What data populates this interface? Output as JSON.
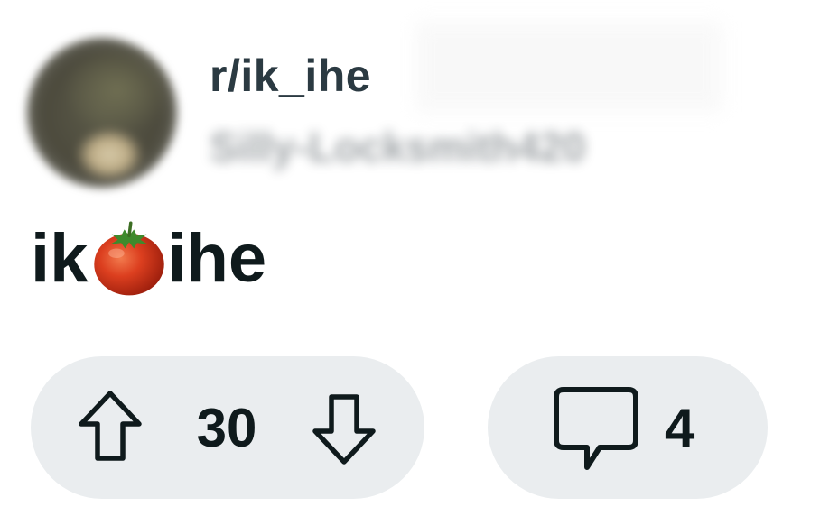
{
  "post": {
    "subreddit": "r/ik_ihe",
    "username": "Silly-Locksmith420",
    "title_part1": "ik",
    "title_emoji": "tomato",
    "title_part2": "ihe"
  },
  "actions": {
    "upvote_icon": "arrow-up-outline-icon",
    "vote_count": "30",
    "downvote_icon": "arrow-down-outline-icon",
    "comment_icon": "speech-bubble-icon",
    "comment_count": "4"
  },
  "colors": {
    "text_primary": "#0f1a1c",
    "subreddit_text": "#2b3a42",
    "pill_background": "#eaedef",
    "tomato_red": "#d8391c"
  }
}
